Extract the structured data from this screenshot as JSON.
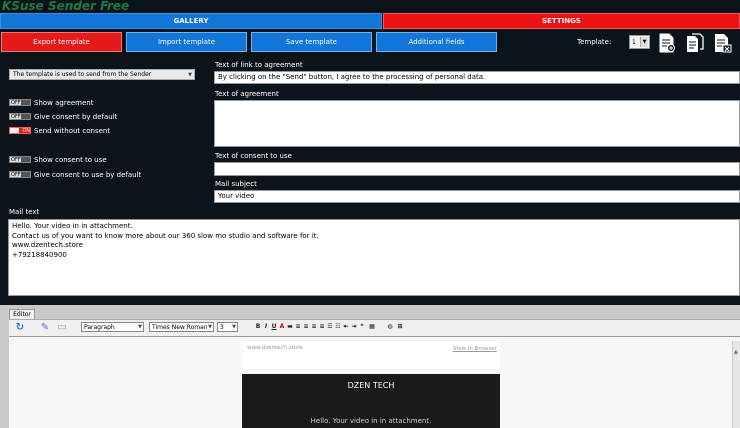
{
  "app": {
    "title": "KSuse Sender Free"
  },
  "tabs": {
    "gallery": "GALLERY",
    "settings": "SETTINGS"
  },
  "toolbar": {
    "export": "Export template",
    "import": "Import template",
    "save": "Save template",
    "additional": "Additional fields",
    "template_label": "Template:",
    "template_value": "1"
  },
  "left": {
    "sender_select": "The template is used to send from the Sender",
    "toggles": [
      {
        "state": "OFF",
        "label": "Show agreement"
      },
      {
        "state": "OFF",
        "label": "Give consent by default"
      },
      {
        "state": "ON",
        "label": "Send without consent"
      },
      {
        "state": "OFF",
        "label": "Show consent to use"
      },
      {
        "state": "OFF",
        "label": "Give consent to use by default"
      }
    ]
  },
  "right": {
    "link_label": "Text of link to agreement",
    "link_value": "By clicking on the \"Send\" button, I agree to the processing of personal data.",
    "agreement_label": "Text of agreement",
    "agreement_value": "",
    "consent_label": "Text of consent to use",
    "consent_value": "",
    "subject_label": "Mail subject",
    "subject_value": "Your video"
  },
  "mail": {
    "label": "Mail text",
    "lines": [
      "Hello. Your video in in attachment.",
      "Contact us of you want to know more about our 360 slow mo studio and software for it.",
      "www.dzentech.store",
      "+79218840900"
    ]
  },
  "editor": {
    "tab": "Editor",
    "format": "Paragraph",
    "font": "Times New Roman",
    "size": "3",
    "preview_url": "www.dzentech.store",
    "view_in_browser": "View in Browser",
    "brand": "DZEN TECH",
    "preview_text": "Hello. Your video in in attachment."
  },
  "colors": {
    "bg": "#0b141b",
    "blue": "#1176d8",
    "red": "#e41a1a"
  }
}
